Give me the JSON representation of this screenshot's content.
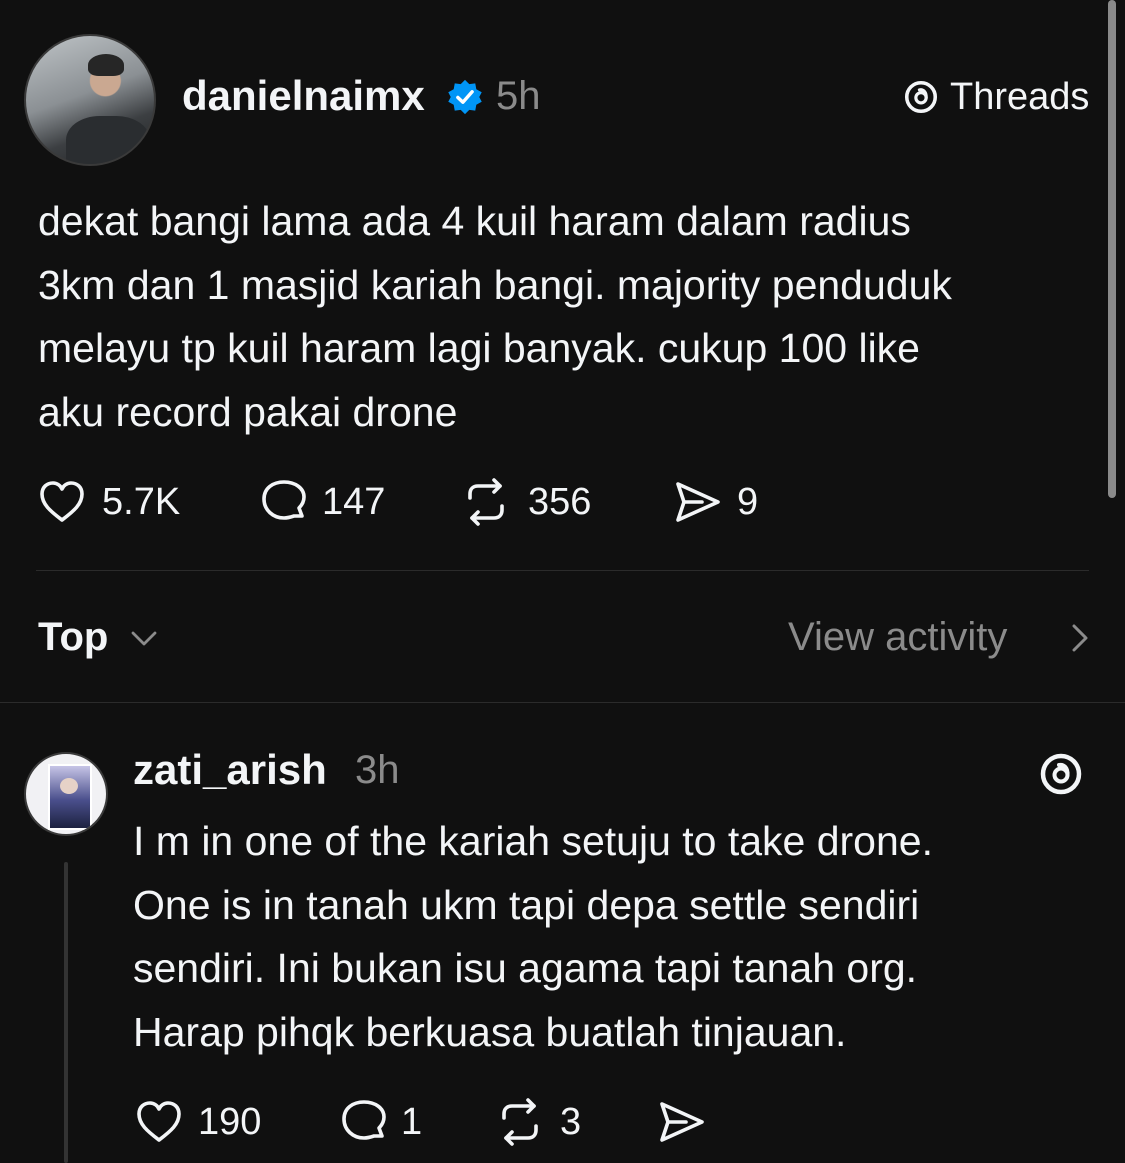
{
  "post": {
    "username": "danielnaimx",
    "verified_icon": "verified-badge-icon",
    "time": "5h",
    "brand_label": "Threads",
    "text_lines": [
      "dekat bangi lama ada 4 kuil haram dalam radius",
      "3km dan 1 masjid kariah bangi. majority penduduk",
      "melayu tp kuil haram lagi banyak. cukup 100 like",
      "aku record pakai drone"
    ],
    "actions": {
      "likes": "5.7K",
      "replies": "147",
      "reposts": "356",
      "shares": "9"
    }
  },
  "sort": {
    "label": "Top",
    "view_activity": "View activity"
  },
  "reply": {
    "username": "zati_arish",
    "time": "3h",
    "text_lines": [
      "I m in one of the kariah setuju to take drone.",
      "One is in tanah ukm tapi depa settle sendiri",
      "sendiri. Ini bukan isu agama tapi tanah org.",
      "Harap pihqk berkuasa buatlah tinjauan."
    ],
    "actions": {
      "likes": "190",
      "replies": "1",
      "reposts": "3"
    }
  },
  "colors": {
    "background": "#101010",
    "text": "#f3f5f7",
    "muted": "#8b8b8b",
    "verified": "#0095f6"
  }
}
